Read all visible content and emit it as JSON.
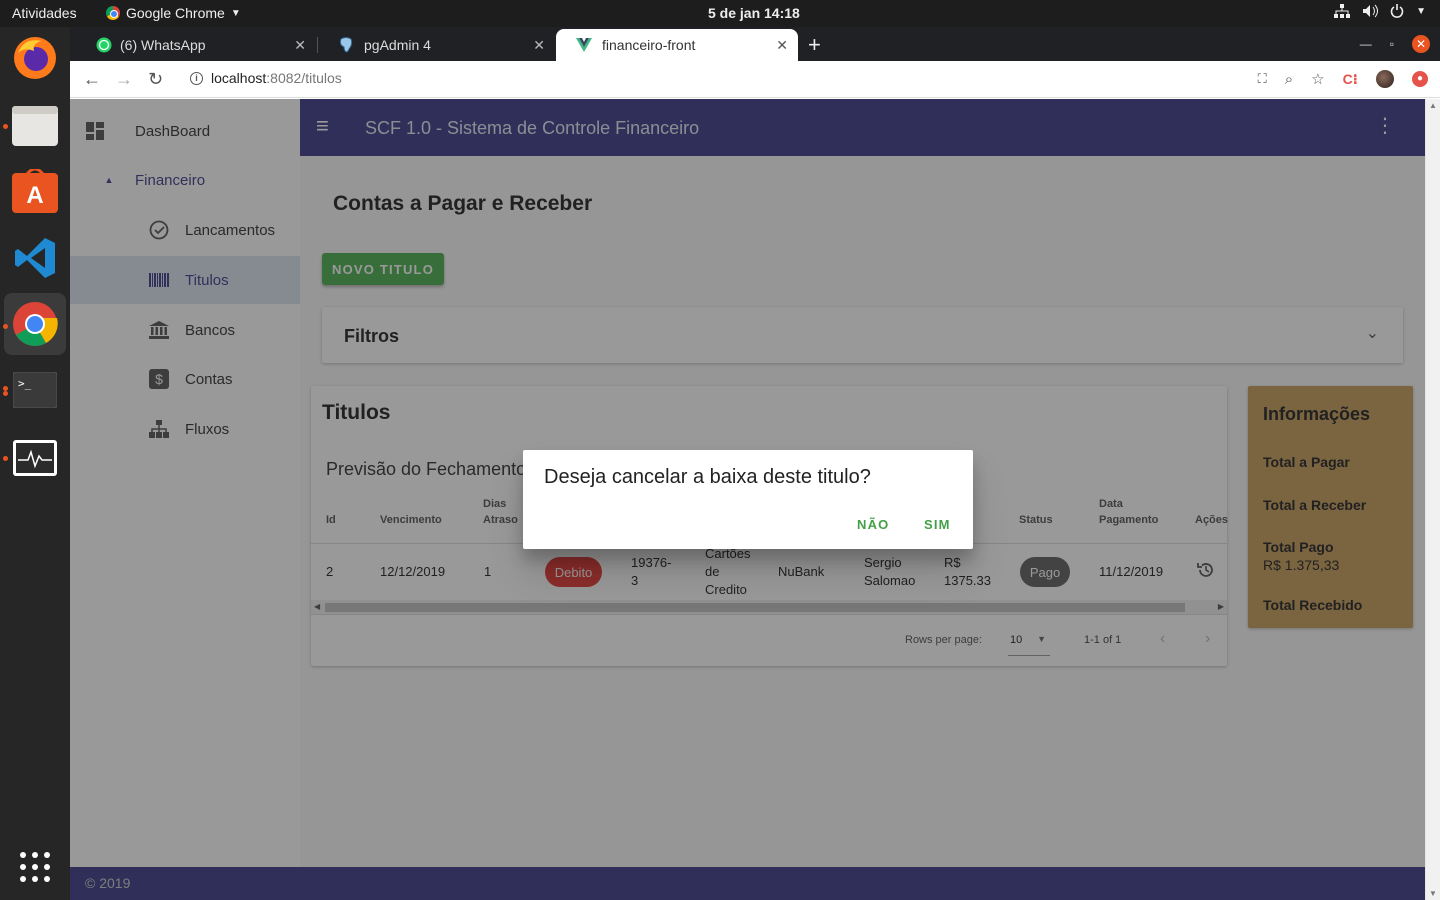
{
  "system": {
    "activities": "Atividades",
    "app_name": "Google Chrome",
    "clock": "5 de jan  14:18"
  },
  "browser": {
    "tabs": [
      {
        "title": "(6) WhatsApp"
      },
      {
        "title": "pgAdmin 4"
      },
      {
        "title": "financeiro-front"
      }
    ],
    "url_host": "localhost",
    "url_path": ":8082/titulos"
  },
  "sidebar": {
    "dashboard": "DashBoard",
    "group": "Financeiro",
    "items": [
      {
        "label": "Lancamentos",
        "icon": "check-circle-icon"
      },
      {
        "label": "Titulos",
        "icon": "barcode-icon"
      },
      {
        "label": "Bancos",
        "icon": "bank-icon"
      },
      {
        "label": "Contas",
        "icon": "dollar-icon"
      },
      {
        "label": "Fluxos",
        "icon": "sitemap-icon"
      }
    ]
  },
  "appbar": {
    "title": "SCF 1.0 - Sistema de Controle Financeiro"
  },
  "page": {
    "title": "Contas a Pagar e Receber",
    "new_button": "NOVO TITULO",
    "filters_label": "Filtros"
  },
  "titulos": {
    "header": "Titulos",
    "subheader": "Previsão do Fechamento",
    "columns": {
      "id": "Id",
      "vencimento": "Vencimento",
      "dias_atraso_1": "Dias",
      "dias_atraso_2": "Atraso",
      "status": "Status",
      "data_pag_1": "Data",
      "data_pag_2": "Pagamento",
      "acoes": "Ações"
    },
    "row": {
      "id": "2",
      "vencimento": "12/12/2019",
      "dias_atraso": "1",
      "tipo": "Debito",
      "documento_1": "19376-",
      "documento_2": "3",
      "categoria_1": "Cartões",
      "categoria_2": "de",
      "categoria_3": "Credito",
      "banco": "NuBank",
      "pessoa_1": "Sergio",
      "pessoa_2": "Salomao",
      "valor_1": "R$",
      "valor_2": "1375.33",
      "status": "Pago",
      "data_pagamento": "11/12/2019"
    },
    "pagination": {
      "rows_per_page_label": "Rows per page:",
      "rows_per_page": "10",
      "range": "1-1 of 1"
    }
  },
  "info": {
    "header": "Informações",
    "total_pagar": "Total a Pagar",
    "total_receber": "Total a Receber",
    "total_pago": "Total Pago",
    "total_pago_value": "R$ 1.375,33",
    "total_recebido": "Total Recebido"
  },
  "footer": {
    "text": "© 2019"
  },
  "dialog": {
    "question": "Deseja cancelar a baixa deste titulo?",
    "no": "NÃO",
    "yes": "SIM"
  },
  "colors": {
    "primary": "#3c3b8a",
    "success": "#4caf50",
    "danger": "#e53935",
    "info_card": "#c79d5b"
  }
}
